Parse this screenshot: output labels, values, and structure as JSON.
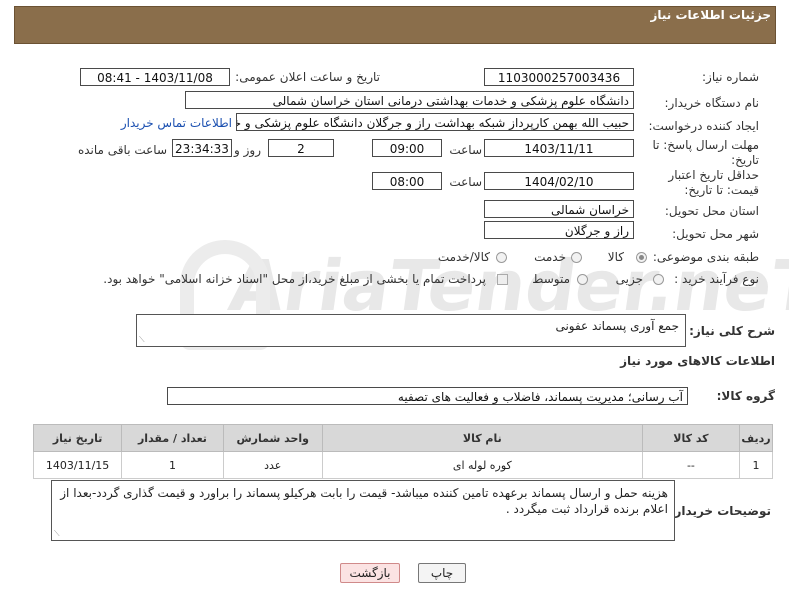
{
  "panel_title": "جزئیات اطلاعات نیاز",
  "fields": {
    "need_number_label": "شماره نیاز:",
    "need_number": "1103000257003436",
    "announce_label": "تاریخ و ساعت اعلان عمومی:",
    "announce_value": "1403/11/08 - 08:41",
    "buyer_label": "نام دستگاه خریدار:",
    "buyer_value": "دانشگاه علوم پزشکی و خدمات بهداشتی درمانی استان خراسان شمالی",
    "creator_label": "ایجاد کننده درخواست:",
    "creator_value": "حبیب الله بهمن کارپرداز شبکه بهداشت راز و جرگلان دانشگاه علوم پزشکی و خد",
    "contact_link": "اطلاعات تماس خریدار",
    "deadline_label": "مهلت ارسال پاسخ: تا تاریخ:",
    "deadline_date": "1403/11/11",
    "time_label": "ساعت",
    "deadline_time": "09:00",
    "days_value": "2",
    "days_label": "روز و",
    "remaining_value": "23:34:33",
    "remaining_label": "ساعت باقی مانده",
    "validity_label": "حداقل تاریخ اعتبار قیمت: تا تاریخ:",
    "validity_date": "1404/02/10",
    "validity_time": "08:00",
    "province_label": "استان محل تحویل:",
    "province_value": "خراسان شمالی",
    "city_label": "شهر محل تحویل:",
    "city_value": "راز و جرگلان",
    "category_label": "طبقه بندی موضوعی:",
    "category_options": [
      "کالا",
      "خدمت",
      "کالا/خدمت"
    ],
    "category_selected": "کالا",
    "process_label": "نوع فرآیند خرید :",
    "process_options": [
      "جزیی",
      "متوسط"
    ],
    "payment_note": "پرداخت تمام یا بخشی از مبلغ خرید،از محل \"اسناد خزانه اسلامی\" خواهد بود."
  },
  "summary": {
    "label": "شرح کلی نیاز:",
    "value": "جمع آوری پسماند عفونی"
  },
  "goods_section_title": "اطلاعات کالاهای مورد نیاز",
  "goods_group": {
    "label": "گروه کالا:",
    "value": "آب رسانی؛ مدیریت پسماند، فاضلاب و فعالیت های تصفیه"
  },
  "table": {
    "headers": [
      "ردیف",
      "کد کالا",
      "نام کالا",
      "واحد شمارش",
      "تعداد / مقدار",
      "تاریخ نیاز"
    ],
    "rows": [
      [
        "1",
        "--",
        "کوره لوله ای",
        "عدد",
        "1",
        "1403/11/15"
      ]
    ]
  },
  "buyer_notes": {
    "label": "توضیحات خریدار:",
    "value": "هزینه حمل و ارسال پسماند برعهده تامین کننده میباشد- قیمت را بابت هرکیلو پسماند را براورد و قیمت گذاری گردد-بعدا از اعلام برنده قرارداد ثبت میگردد ."
  },
  "buttons": {
    "print": "چاپ",
    "back": "بازگشت"
  },
  "watermark": "AriaTender.neT",
  "colors": {
    "panel": "#8a6e4b",
    "link": "#1a4fb0",
    "back_button_bg": "#fbe3e3",
    "back_button_border": "#d08a8a"
  }
}
